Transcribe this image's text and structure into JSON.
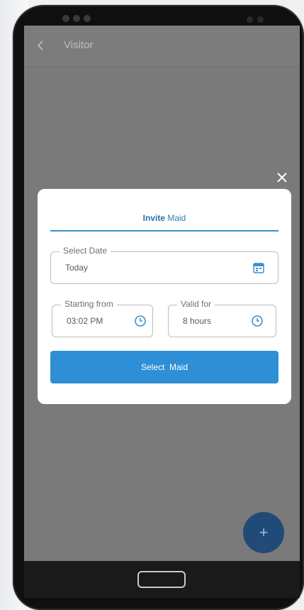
{
  "appbar": {
    "title": "Visitor"
  },
  "dialog": {
    "title_bold": "Invite",
    "title_rest": "Maid",
    "select_date": {
      "label": "Select Date",
      "value": "Today"
    },
    "starting_from": {
      "label": "Starting from",
      "value": "03:02 PM"
    },
    "valid_for": {
      "label": "Valid for",
      "value": "8 hours"
    },
    "select_button": {
      "text": "Select",
      "suffix": "Maid"
    }
  },
  "fab": {
    "label": "+"
  },
  "colors": {
    "accent": "#2f8fd6",
    "fab": "#214a78",
    "overlay": "#7a7a7a"
  },
  "icons": [
    "back-icon",
    "close-icon",
    "calendar-icon",
    "clock-icon",
    "plus-icon"
  ]
}
